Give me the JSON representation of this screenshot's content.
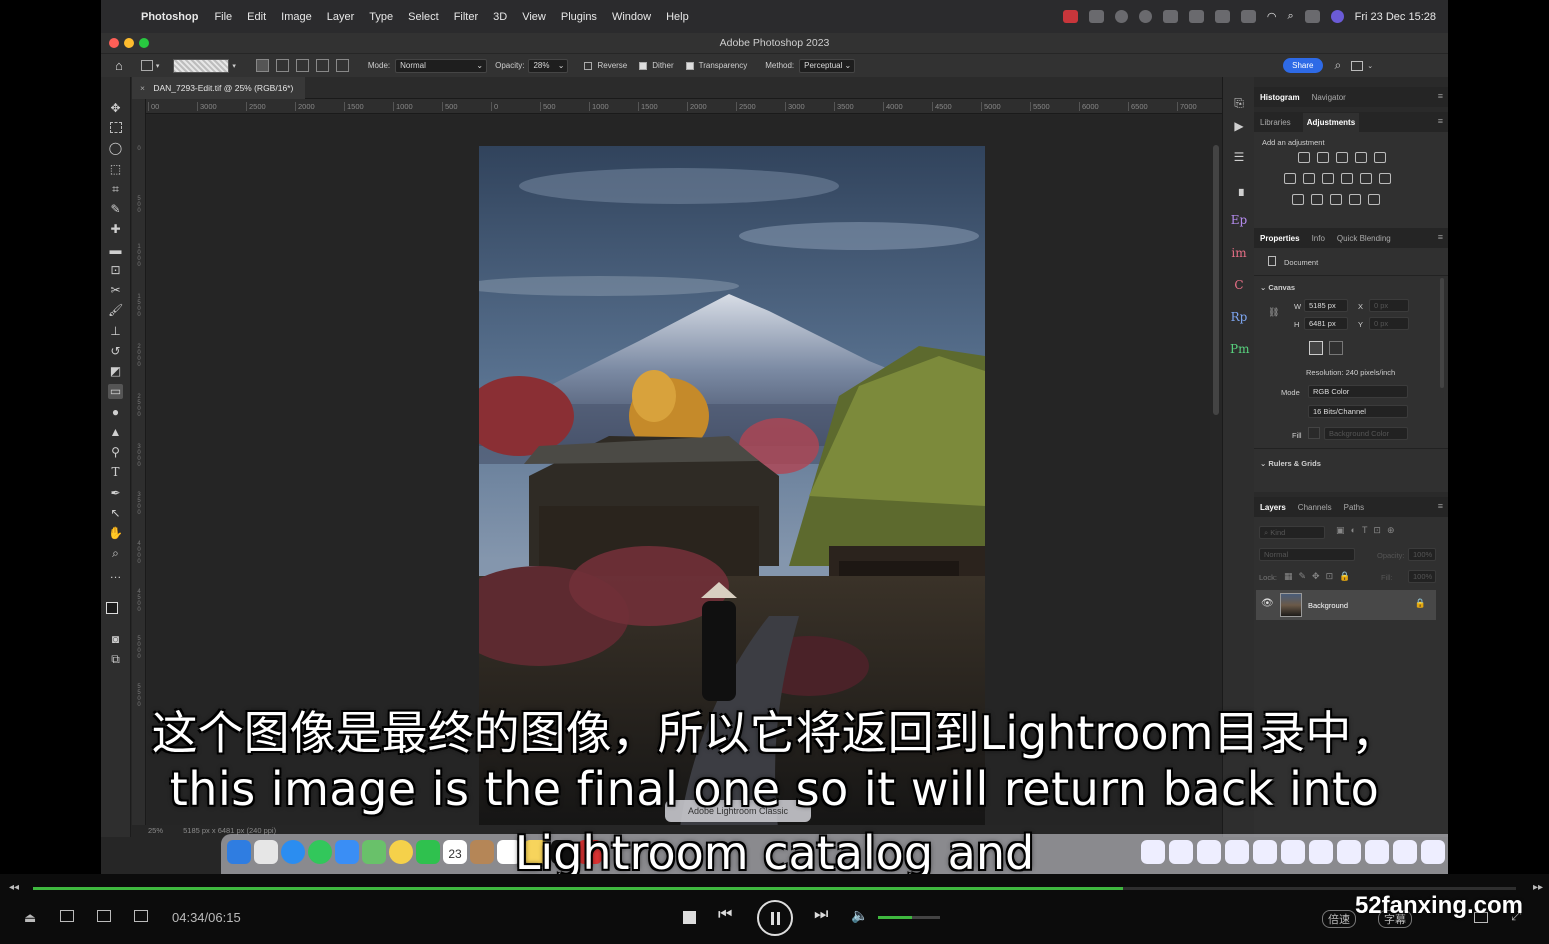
{
  "menubar": {
    "app_name": "Photoshop",
    "items": [
      "File",
      "Edit",
      "Image",
      "Layer",
      "Type",
      "Select",
      "Filter",
      "3D",
      "View",
      "Plugins",
      "Window",
      "Help"
    ],
    "clock": "Fri 23 Dec  15:28"
  },
  "window": {
    "title": "Adobe Photoshop 2023"
  },
  "options": {
    "mode_label": "Mode:",
    "mode_value": "Normal",
    "opacity_label": "Opacity:",
    "opacity_value": "28%",
    "reverse_label": "Reverse",
    "dither_label": "Dither",
    "transparency_label": "Transparency",
    "method_label": "Method:",
    "method_value": "Perceptual",
    "share_label": "Share"
  },
  "document": {
    "tab_title": "DAN_7293-Edit.tif @ 25% (RGB/16*)",
    "ruler_labels": [
      "00",
      "3000",
      "2500",
      "2000",
      "1500",
      "1000",
      "500",
      "0",
      "500",
      "1000",
      "1500",
      "2000",
      "2500",
      "3000",
      "3500",
      "4000",
      "4500",
      "5000",
      "5500",
      "6000",
      "6500",
      "7000"
    ],
    "zoom": "25%",
    "dimensions": "5185 px x 6481 px (240 ppi)"
  },
  "panels": {
    "top_tabs": [
      "Histogram",
      "Navigator"
    ],
    "adj_tabs": [
      "Libraries",
      "Adjustments"
    ],
    "add_adjustment": "Add an adjustment",
    "prop_tabs": [
      "Properties",
      "Info",
      "Quick Blending"
    ],
    "document_label": "Document",
    "canvas_label": "Canvas",
    "w_label": "W",
    "w_value": "5185 px",
    "h_label": "H",
    "h_value": "6481 px",
    "x_label": "X",
    "x_value": "0 px",
    "y_label": "Y",
    "y_value": "0 px",
    "resolution": "Resolution: 240 pixels/inch",
    "mode_label": "Mode",
    "mode_value": "RGB Color",
    "depth_value": "16 Bits/Channel",
    "fill_label": "Fill",
    "fill_value": "Background Color",
    "rulers_label": "Rulers & Grids",
    "layer_tabs": [
      "Layers",
      "Channels",
      "Paths"
    ],
    "kind_label": "Kind",
    "blend_value": "Normal",
    "opacity_label": "Opacity:",
    "opacity_value": "100%",
    "lock_label": "Lock:",
    "fill2_label": "Fill:",
    "fill2_value": "100%",
    "layer_name": "Background"
  },
  "dock": {
    "tooltip": "Adobe Lightroom Classic",
    "calendar_day": "23"
  },
  "subtitles": {
    "chinese": "这个图像是最终的图像，所以它将返回到Lightroom目录中，",
    "english": "this image is the final one so it will return back into",
    "english_cont": "Lightroom catalog and"
  },
  "player": {
    "time": "04:34/06:15",
    "progress": 0.735,
    "volume": 0.55,
    "speed_label": "倍速",
    "subtitle_label": "字幕",
    "watermark": "52fanxing.com"
  },
  "colors": {
    "accent_green": "#3fb83f",
    "share_blue": "#2e6ae6"
  }
}
